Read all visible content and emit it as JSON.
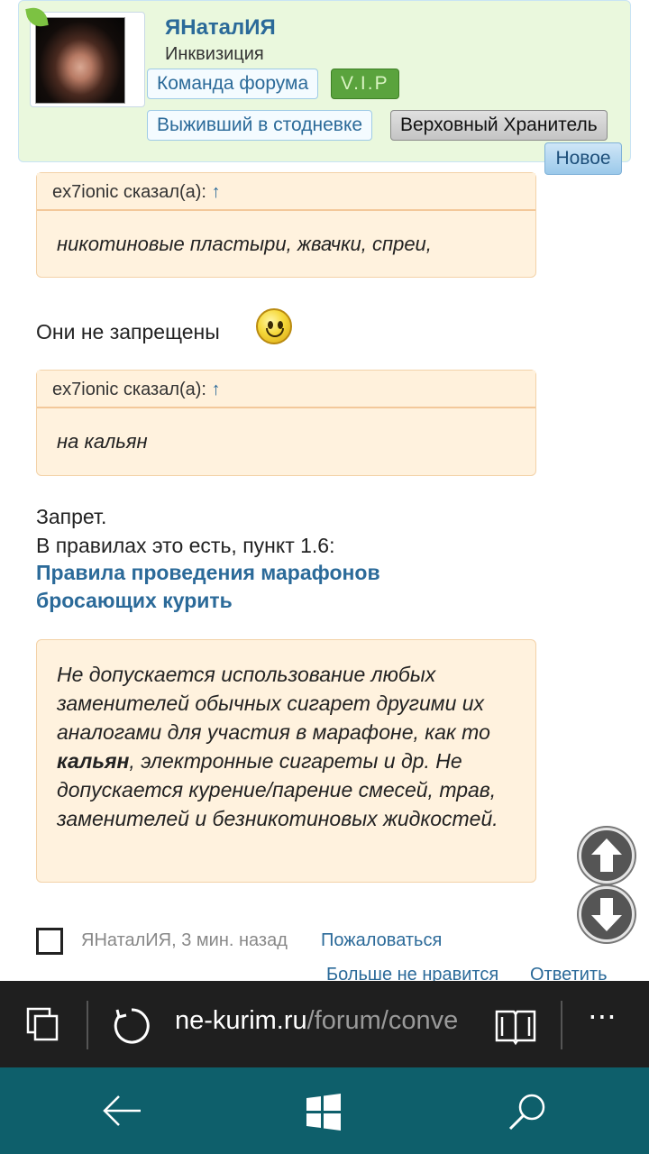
{
  "profile": {
    "username": "ЯНаталИЯ",
    "user_title": "Инквизиция",
    "badges": [
      "Команда форума",
      "V.I.P",
      "Выживший в стодневке",
      "Верховный Хранитель"
    ],
    "new_label": "Новое"
  },
  "quote1": {
    "author": "ex7ionic сказал(а):",
    "arrow": "↑",
    "text": "никотиновые пластыри, жвачки, спреи,"
  },
  "reply1": "Они не запрещены",
  "quote2": {
    "author": "ex7ionic сказал(а):",
    "arrow": "↑",
    "text": "на кальян"
  },
  "reply2": {
    "line1": "Запрет.",
    "line2": "В правилах это есть, пункт 1.6:",
    "link": "Правила проведения марафонов бросающих курить"
  },
  "rule_quote": {
    "before": "Не допускается использование любых заменителей обычных сигарет другими их аналогами для участия в марафоне, как то ",
    "bold": "кальян",
    "after": ", электронные сигареты и др. Не допускается курение/парение смесей, трав, заменителей и безникотиновых жидкостей."
  },
  "post_footer": {
    "meta": "ЯНаталИЯ, 3 мин. назад",
    "report": "Пожаловаться",
    "unlike": "Больше не нравится",
    "reply": "Ответить"
  },
  "browser": {
    "url_domain": "ne-kurim.ru",
    "url_rest": "/forum/conve",
    "more": "⋯"
  }
}
